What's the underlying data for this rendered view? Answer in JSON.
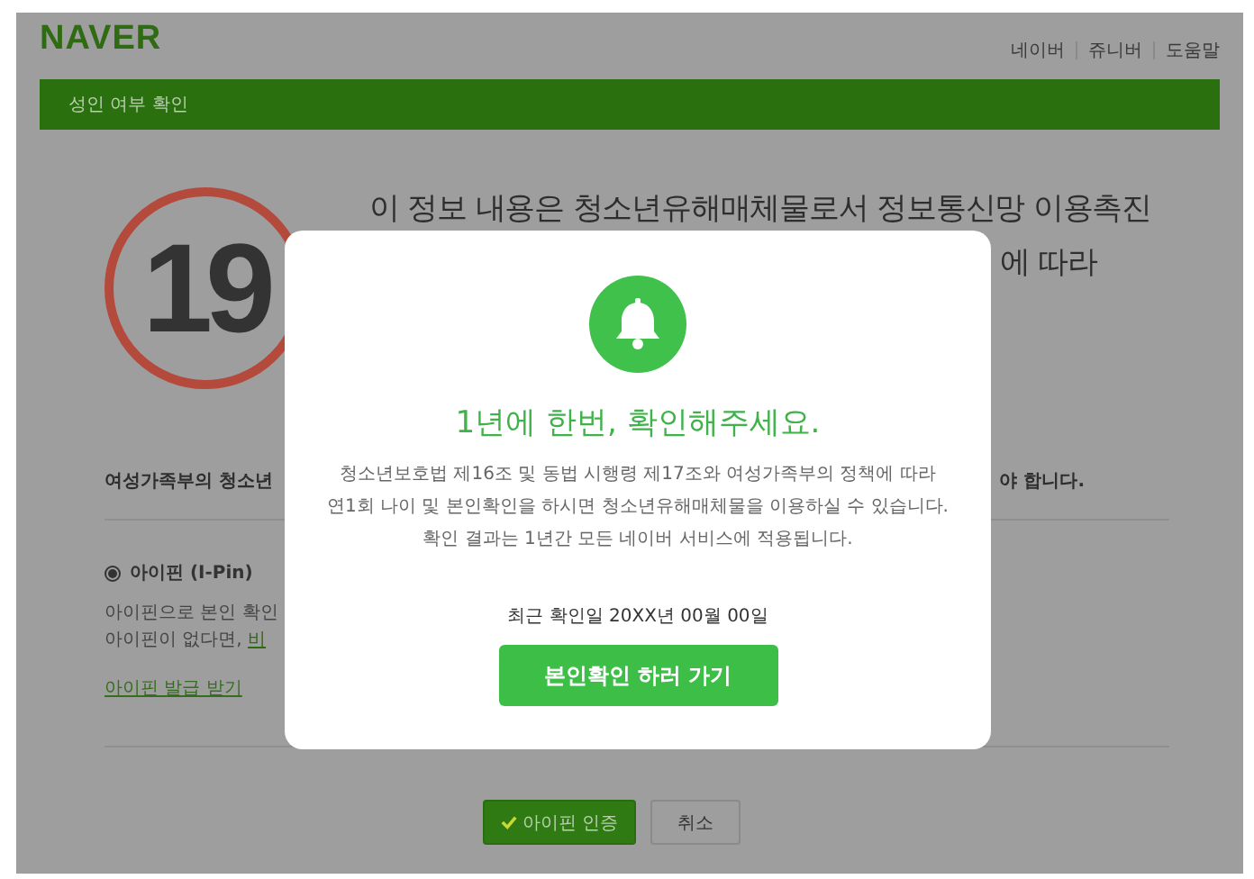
{
  "header": {
    "logo": "NAVER",
    "links": [
      "네이버",
      "쥬니버",
      "도움말"
    ]
  },
  "title_bar": {
    "title": "성인 여부 확인"
  },
  "age_badge": {
    "text": "19"
  },
  "headline": [
    "이 정보 내용은 청소년유해매체물로서 정보통신망 이용촉진",
    "에 따라"
  ],
  "notice": {
    "left": "여성가족부의 청소년",
    "right": "야 합니다."
  },
  "methods": [
    {
      "label": "아이핀 (I-Pin)",
      "selected": true
    }
  ],
  "method_lines": [
    {
      "text": "아이핀으로 본인 확인"
    },
    {
      "text": "아이핀이 없다면,",
      "link": "비"
    }
  ],
  "issue_link": "아이핀 발급 받기",
  "buttons": [
    {
      "label": "아이핀 인증",
      "kind": "primary"
    },
    {
      "label": "취소",
      "kind": "secondary"
    }
  ],
  "modal": {
    "title": "1년에 한번, 확인해주세요.",
    "body": [
      "청소년보호법 제16조 및 동법 시행령 제17조와 여성가족부의 정책에 따라",
      "연1회 나이 및 본인확인을 하시면 청소년유해매체물을 이용하실 수 있습니다.",
      "확인 결과는 1년간 모든 네이버 서비스에 적용됩니다."
    ],
    "last_check": "최근 확인일 20XX년 00월 00일",
    "button": "본인확인 하러 가기"
  }
}
